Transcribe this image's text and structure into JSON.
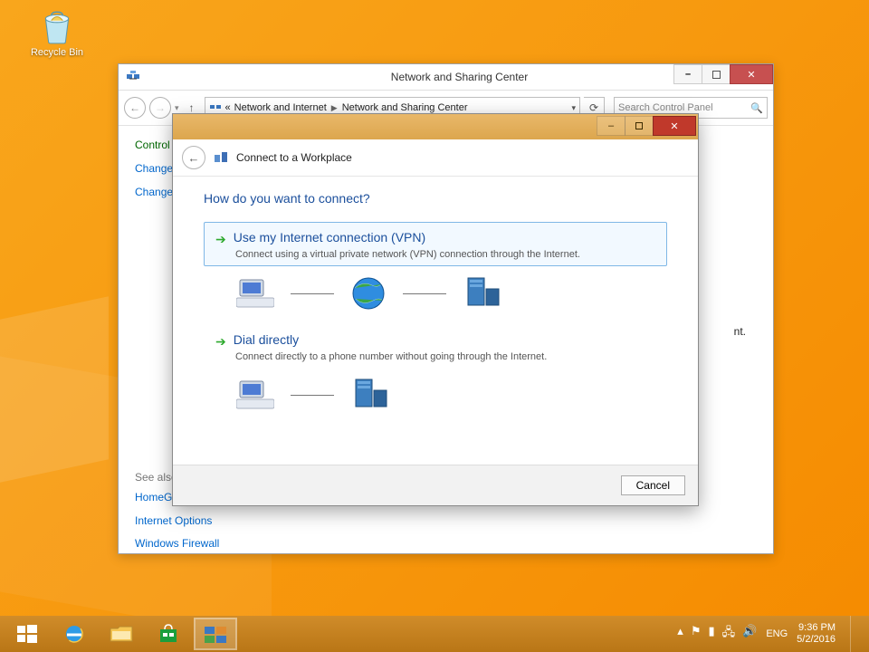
{
  "desktop": {
    "recycle_label": "Recycle Bin"
  },
  "window": {
    "title": "Network and Sharing Center",
    "breadcrumb": {
      "root": "«",
      "a": "Network and Internet",
      "b": "Network and Sharing Center"
    },
    "search_placeholder": "Search Control Panel",
    "sidebar": {
      "header": "Control Panel Home",
      "link1": "Change adapter settings",
      "link2": "Change advanced sharing settings",
      "seealso_label": "See also",
      "seealso": [
        "HomeGroup",
        "Internet Options",
        "Windows Firewall"
      ]
    },
    "content_hint": "nt."
  },
  "wizard": {
    "title": "Connect to a Workplace",
    "question": "How do you want to connect?",
    "opt1": {
      "title": "Use my Internet connection (VPN)",
      "sub": "Connect using a virtual private network (VPN) connection through the Internet."
    },
    "opt2": {
      "title": "Dial directly",
      "sub": "Connect directly to a phone number without going through the Internet."
    },
    "cancel": "Cancel"
  },
  "taskbar": {
    "lang": "ENG",
    "time": "9:36 PM",
    "date": "5/2/2016"
  }
}
